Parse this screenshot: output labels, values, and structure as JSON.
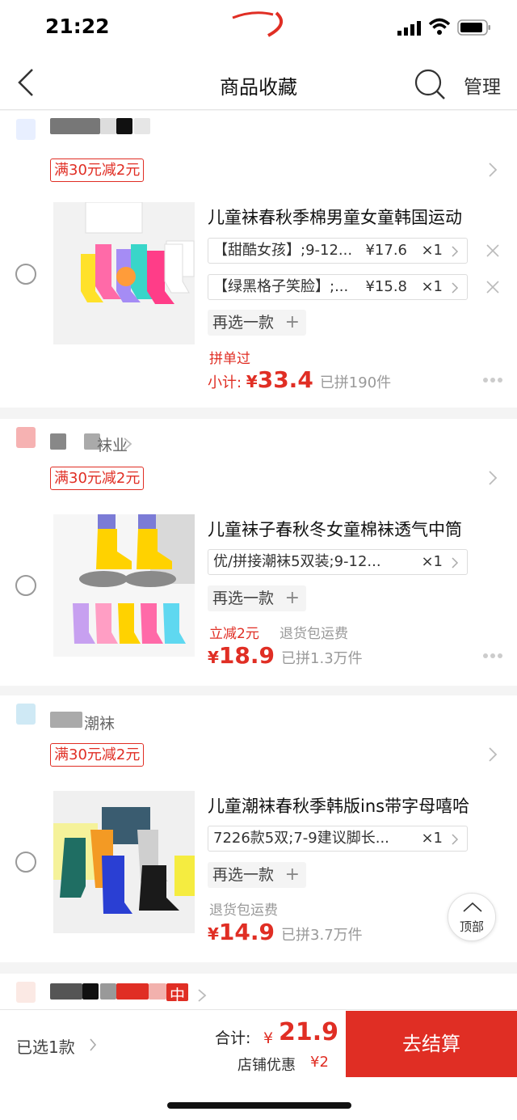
{
  "status_bar": {
    "time": "21:22"
  },
  "nav": {
    "title": "商品收藏",
    "manage": "管理"
  },
  "stores": [
    {
      "name": "",
      "promo": "满30元减2元",
      "product": {
        "title": "儿童袜春秋季棉男童女童韩国运动",
        "skus": [
          {
            "spec": "【甜酷女孩】;9-12...",
            "price": "¥17.6",
            "qty": "×1"
          },
          {
            "spec": "【绿黑格子笑脸】;...",
            "price": "¥15.8",
            "qty": "×1"
          }
        ],
        "reselect": "再选一款",
        "tag": "拼单过",
        "price_prefix": "小计: ",
        "price_yen": "¥",
        "price": "33.4",
        "sold": "已拼190件"
      }
    },
    {
      "name": "袜业",
      "promo": "满30元减2元",
      "product": {
        "title": "儿童袜子春秋冬女童棉袜透气中筒",
        "skus": [
          {
            "spec": "优/拼接潮袜5双装;9-12...",
            "price": "",
            "qty": "×1"
          }
        ],
        "reselect": "再选一款",
        "tag": "立减2元",
        "tag2": "退货包运费",
        "price_yen": "¥",
        "price": "18.9",
        "sold": "已拼1.3万件"
      }
    },
    {
      "name": "潮袜",
      "promo": "满30元减2元",
      "product": {
        "title": "儿童潮袜春秋季韩版ins带字母嘻哈",
        "skus": [
          {
            "spec": "7226款5双;7-9建议脚长...",
            "price": "",
            "qty": "×1"
          }
        ],
        "reselect": "再选一款",
        "tag": "退货包运费",
        "price_yen": "¥",
        "price": "14.9",
        "sold": "已拼3.7万件"
      }
    },
    {
      "name": "中"
    }
  ],
  "top_button": {
    "label": "顶部"
  },
  "bottom": {
    "selected": "已选1款",
    "total_label": "合计:",
    "total_yen": "¥",
    "total": "21.9",
    "discount_label": "店铺优惠",
    "discount": "¥2",
    "checkout": "去结算"
  },
  "colors": {
    "accent": "#e02e24",
    "background": "#f4f4f4"
  }
}
